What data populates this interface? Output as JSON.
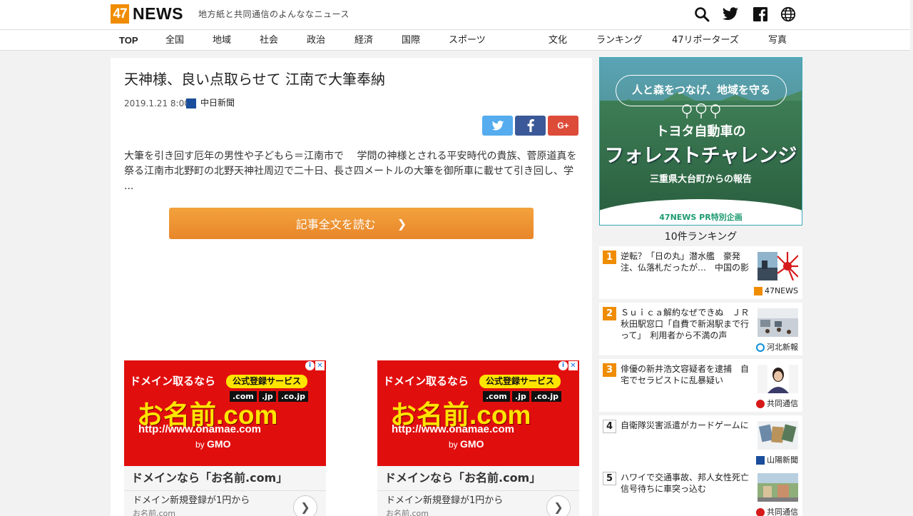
{
  "header": {
    "logo_num": "47",
    "logo_word": "NEWS",
    "tagline": "地方紙と共同通信のよんななニュース",
    "icons": [
      "search-icon",
      "twitter-icon",
      "facebook-icon",
      "globe-icon"
    ]
  },
  "nav": {
    "items": [
      "TOP",
      "全国",
      "地域",
      "社会",
      "政治",
      "経済",
      "国際",
      "スポーツ",
      "文化",
      "ランキング",
      "47リポーターズ",
      "写真"
    ]
  },
  "article": {
    "title": "天神様、良い点取らせて 江南で大筆奉納",
    "date": "2019.1.21 8:00",
    "source": "中日新聞",
    "share": {
      "gplus": "G+"
    },
    "summary": "大筆を引き回す厄年の男性や子どもら＝江南市で　 学問の神様とされる平安時代の貴族、菅原道真を祭る江南市北野町の北野天神社周辺で二十日、長さ四メートルの大筆を御所車に載せて引き回し、学 ...",
    "read_button": "記事全文を読む"
  },
  "ads": [
    {
      "line1": "ドメイン取るなら",
      "badge": "公式登録サービス",
      "tlds": [
        ".com",
        ".jp",
        ".co.jp"
      ],
      "brand": "お名前.com",
      "url": "http://www.onamae.com",
      "by": "by",
      "gmo": "GMO",
      "headline": "ドメインなら「お名前.com」",
      "sub": "ドメイン新規登録が1円から",
      "domain": "お名前.com"
    },
    {
      "line1": "ドメイン取るなら",
      "badge": "公式登録サービス",
      "tlds": [
        ".com",
        ".jp",
        ".co.jp"
      ],
      "brand": "お名前.com",
      "url": "http://www.onamae.com",
      "by": "by",
      "gmo": "GMO",
      "headline": "ドメインなら「お名前.com」",
      "sub": "ドメイン新規登録が1円から",
      "domain": "お名前.com"
    }
  ],
  "pr": {
    "banner": "人と森をつなげ、地域を守る",
    "toyota": "トヨタ自動車の",
    "challenge": "フォレストチャレンジ",
    "report": "三重県大台町からの報告",
    "label": "47NEWS PR特別企画"
  },
  "ranking": {
    "title": "10件ランキング",
    "items": [
      {
        "num": "1",
        "text": "逆転？「日の丸」潜水艦　豪発注、仏落札だったが…　中国の影",
        "source": "47NEWS"
      },
      {
        "num": "2",
        "text": "Ｓｕｉｃａ解約なぜできぬ　ＪＲ秋田駅窓口「自費で新潟駅まで行って」　利用者から不満の声",
        "source": "河北新報"
      },
      {
        "num": "3",
        "text": "俳優の新井浩文容疑者を逮捕　自宅でセラピストに乱暴疑い",
        "source": "共同通信"
      },
      {
        "num": "4",
        "text": "自衛隊災害派遣がカードゲームに",
        "source": "山陽新聞"
      },
      {
        "num": "5",
        "text": "ハワイで交通事故、邦人女性死亡　信号待ちに車突っ込む",
        "source": "共同通信"
      }
    ]
  }
}
